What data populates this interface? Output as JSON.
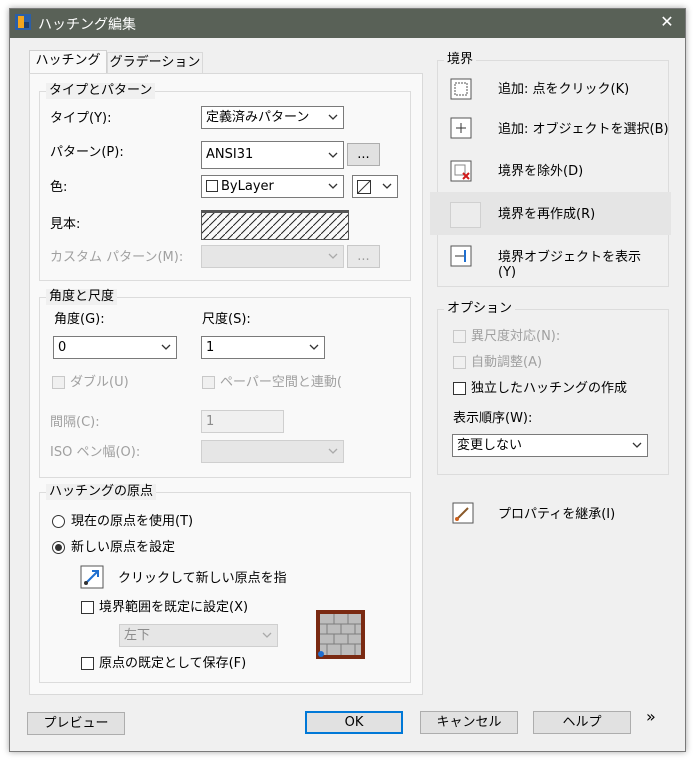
{
  "window": {
    "title": "ハッチング編集",
    "close_glyph": "✕"
  },
  "tabs": [
    {
      "label": "ハッチング"
    },
    {
      "label": "グラデーション"
    }
  ],
  "type_pattern": {
    "group_title": "タイプとパターン",
    "type_label": "タイプ(Y):",
    "type_value": "定義済みパターン",
    "pattern_label": "パターン(P):",
    "pattern_value": "ANSI31",
    "pattern_browse": "...",
    "color_label": "色:",
    "color_value": "ByLayer",
    "swatch_label": "見本:",
    "custom_label": "カスタム パターン(M):",
    "custom_browse": "..."
  },
  "angle_scale": {
    "group_title": "角度と尺度",
    "angle_label": "角度(G):",
    "angle_value": "0",
    "scale_label": "尺度(S):",
    "scale_value": "1",
    "double_label": "ダブル(U)",
    "paperspace_label": "ペーパー空間と連動(",
    "spacing_label": "間隔(C):",
    "spacing_value": "1",
    "iso_label": "ISO ペン幅(O):"
  },
  "origin": {
    "group_title": "ハッチングの原点",
    "use_current": "現在の原点を使用(T)",
    "specify_new": "新しい原点を設定",
    "click_new": "クリックして新しい原点を指",
    "default_extents": "境界範囲を既定に設定(X)",
    "position_value": "左下",
    "store_default": "原点の既定として保存(F)"
  },
  "boundaries": {
    "group_title": "境界",
    "add_pick": "追加: 点をクリック(K)",
    "add_select": "追加: オブジェクトを選択(B)",
    "remove": "境界を除外(D)",
    "recreate": "境界を再作成(R)",
    "view_selections": "境界オブジェクトを表示(Y)"
  },
  "options": {
    "group_title": "オプション",
    "annotative": "異尺度対応(N):",
    "associative": "自動調整(A)",
    "separate": "独立したハッチングの作成",
    "draw_order_label": "表示順序(W):",
    "draw_order_value": "変更しない"
  },
  "inherit": "プロパティを継承(I)",
  "buttons": {
    "preview": "プレビュー",
    "ok": "OK",
    "cancel": "キャンセル",
    "help": "ヘルプ",
    "more": "»"
  }
}
